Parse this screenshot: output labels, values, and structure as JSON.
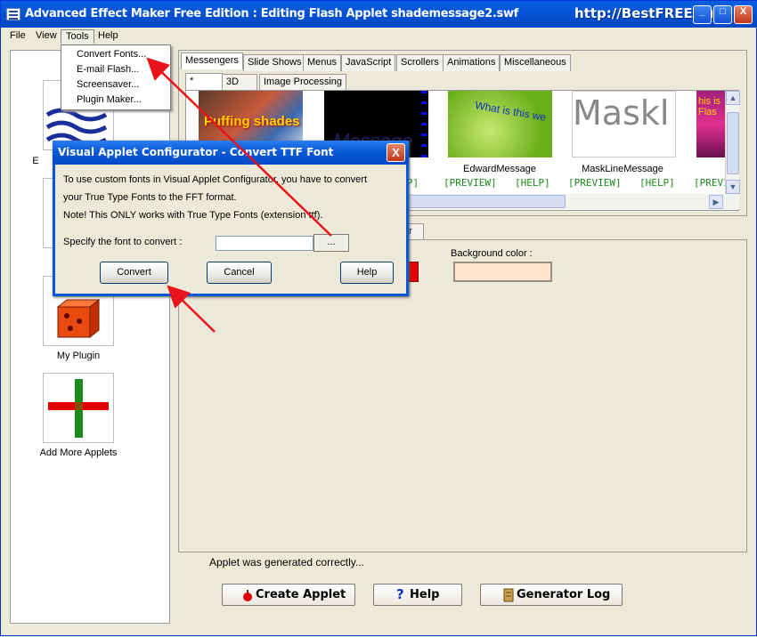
{
  "window": {
    "title": "Advanced Effect Maker Free Edition : Editing Flash Applet shademessage2.swf",
    "watermark": "http://BestFREE.ru",
    "minimize": "_",
    "maximize": "□",
    "close": "X"
  },
  "menu": {
    "file": "File",
    "view": "View",
    "tools": "Tools",
    "help": "Help"
  },
  "tools_menu": [
    "Convert Fonts...",
    "E-mail Flash...",
    "Screensaver...",
    "Plugin Maker..."
  ],
  "sidebar": {
    "partial_label": "E",
    "my_plugin": "My Plugin",
    "add_more": "Add More Applets"
  },
  "tabs_row1": [
    "Messengers",
    "Slide Shows",
    "Menus",
    "JavaScript",
    "Scrollers",
    "Animations",
    "Miscellaneous"
  ],
  "tabs_row2": [
    "*",
    "3D",
    "Image Processing"
  ],
  "gallery": {
    "thumb1_text": "Puffing shades",
    "thumb2_text": "Message",
    "thumb3_text": "What is this we",
    "thumb4_text": "Maskl",
    "thumb5_text": "his is Flas",
    "items": [
      {
        "name": "sage",
        "preview": "",
        "help": "HELP]"
      },
      {
        "name": "EdwardMessage",
        "preview": "[PREVIEW]",
        "help": "[HELP]"
      },
      {
        "name": "MaskLineMessage",
        "preview": "[PREVIEW]",
        "help": "[HELP]"
      },
      {
        "name": "",
        "preview": "[PREVI",
        "help": ""
      }
    ]
  },
  "settings": {
    "partial_tab": "er",
    "bg_color_label": "Background color :",
    "bg_color": "#fde3cd"
  },
  "status_text": "Applet was generated correctly...",
  "buttons": {
    "create": "Create Applet",
    "help": "Help",
    "log": "Generator Log"
  },
  "dialog": {
    "title": "Visual Applet Configurator - Convert TTF Font",
    "line1": "To use custom fonts in Visual Applet Configurator, you have to convert",
    "line2": "your True Type Fonts to the FFT format.",
    "line3": "Note! This ONLY works with True Type Fonts (extension ttf).",
    "specify_label": "Specify the font to convert :",
    "font_value": "",
    "browse": "...",
    "convert": "Convert",
    "cancel": "Cancel",
    "help": "Help",
    "close": "X"
  },
  "colors": {
    "arrow": "#e8131b",
    "link_green": "#1c8a1c",
    "titlebar_blue": "#0454d6"
  }
}
